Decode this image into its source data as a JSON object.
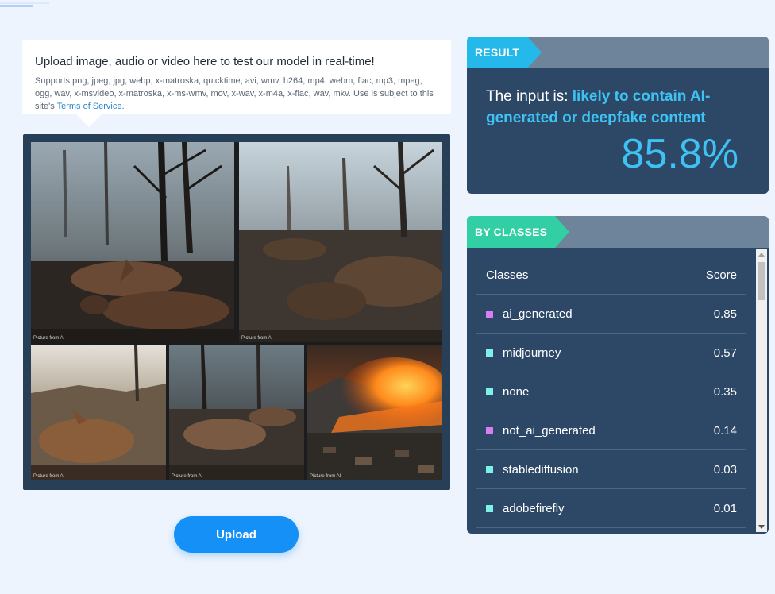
{
  "upload_info": {
    "title": "Upload image, audio or video here to test our model in real-time!",
    "supports_text": "Supports png, jpeg, jpg, webp, x-matroska, quicktime, avi, wmv, h264, mp4, webm, flac, mp3, mpeg, ogg, wav, x-msvideo, x-matroska, x-ms-wmv, mov, x-wav, x-m4a, x-flac, wav, mkv. Use is subject to this site's ",
    "tos_link": "Terms of Service",
    "tos_suffix": "."
  },
  "image": {
    "captions": [
      "Picture from AI",
      "Picture from AI",
      "Picture from AI",
      "Picture from AI",
      "Picture from AI"
    ]
  },
  "upload_button": {
    "label": "Upload"
  },
  "result": {
    "tag": "RESULT",
    "prefix": "The input is: ",
    "verdict": "likely to contain AI-generated or deepfake content",
    "percentage": "85.8%",
    "accent_color": "#3ec2f3"
  },
  "by_classes": {
    "tag": "BY CLASSES",
    "header_class": "Classes",
    "header_score": "Score",
    "rows": [
      {
        "label": "ai_generated",
        "score": "0.85",
        "color": "#d77ff0"
      },
      {
        "label": "midjourney",
        "score": "0.57",
        "color": "#7ff0e8"
      },
      {
        "label": "none",
        "score": "0.35",
        "color": "#7ff0e8"
      },
      {
        "label": "not_ai_generated",
        "score": "0.14",
        "color": "#d77ff0"
      },
      {
        "label": "stablediffusion",
        "score": "0.03",
        "color": "#7ff0e8"
      },
      {
        "label": "adobefirefly",
        "score": "0.01",
        "color": "#7ff0e8"
      }
    ]
  }
}
